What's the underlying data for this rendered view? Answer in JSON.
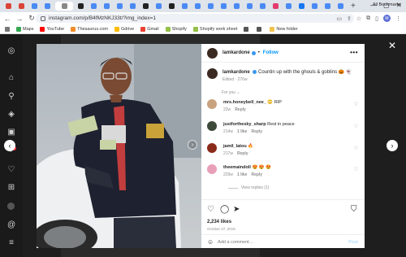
{
  "browser": {
    "url": "instagram.com/p/B4fMzNKJ33t/?img_index=1",
    "tabs": [
      {
        "color": "#db4437"
      },
      {
        "color": "#db4437"
      },
      {
        "color": "#4a8af4"
      },
      {
        "color": "#4a8af4"
      },
      {
        "color": "#888888"
      },
      {
        "color": "#222222"
      },
      {
        "color": "#4a8af4"
      },
      {
        "color": "#4a8af4"
      },
      {
        "color": "#4a8af4"
      },
      {
        "color": "#4a8af4"
      },
      {
        "color": "#222222"
      },
      {
        "color": "#4a8af4"
      },
      {
        "color": "#222222"
      },
      {
        "color": "#4a8af4"
      },
      {
        "color": "#4a8af4"
      },
      {
        "color": "#4a8af4"
      },
      {
        "color": "#4a8af4"
      },
      {
        "color": "#4a8af4"
      },
      {
        "color": "#4a8af4"
      },
      {
        "color": "#4a8af4"
      },
      {
        "color": "#e33b6c"
      },
      {
        "color": "#4a8af4"
      },
      {
        "color": "#1877f2"
      },
      {
        "color": "#4a8af4"
      },
      {
        "color": "#4a8af4"
      },
      {
        "color": "#4a8af4"
      }
    ],
    "new_tab": "+",
    "profile_initial": "M",
    "bookmarks": [
      {
        "label": "Maps",
        "color": "#34a853"
      },
      {
        "label": "YouTube",
        "color": "#ff0000"
      },
      {
        "label": "Thesaurus.com",
        "color": "#f28c28"
      },
      {
        "label": "Gdrive",
        "color": "#fbbc04"
      },
      {
        "label": "Gmail",
        "color": "#ea4335"
      },
      {
        "label": "Shopify",
        "color": "#95bf47"
      },
      {
        "label": "Shopify work sheet",
        "color": "#95bf47"
      },
      {
        "label": "",
        "color": "#555555"
      },
      {
        "label": "",
        "color": "#555555"
      },
      {
        "label": "New folder",
        "color": "#f2c14e"
      }
    ],
    "all_bookmarks": "All Bookmarks"
  },
  "post": {
    "username": "lamkardone",
    "follow_label": "Follow",
    "separator": "•",
    "more": "•••",
    "caption": "Countin up with the ghouls & goblins 🎃 👻",
    "edited": "Edited · 276w",
    "for_you": "For you",
    "comments": [
      {
        "user": "mrs.honeybell_nee_",
        "text": "😳 RIP",
        "time": "22w",
        "reply": "Reply",
        "likes": "",
        "avatar": "#c9a27e"
      },
      {
        "user": "justforthesky_sharp",
        "text": "Rest in peace",
        "time": "214w",
        "likes": "1 like",
        "reply": "Reply",
        "avatar": "#3d4a3a"
      },
      {
        "user": "jamil_latou",
        "text": "🔥",
        "time": "217w",
        "reply": "Reply",
        "likes": "",
        "avatar": "#8a2a1a"
      },
      {
        "user": "theemaindoll",
        "text": "😍 😍 😍",
        "time": "229w",
        "likes": "1 like",
        "reply": "Reply",
        "avatar": "#e8a0b8"
      }
    ],
    "view_replies": "View replies (1)",
    "likes": "2,234 likes",
    "date": "October 27, 2019",
    "add_comment_placeholder": "Add a comment…",
    "post_label": "Post"
  }
}
